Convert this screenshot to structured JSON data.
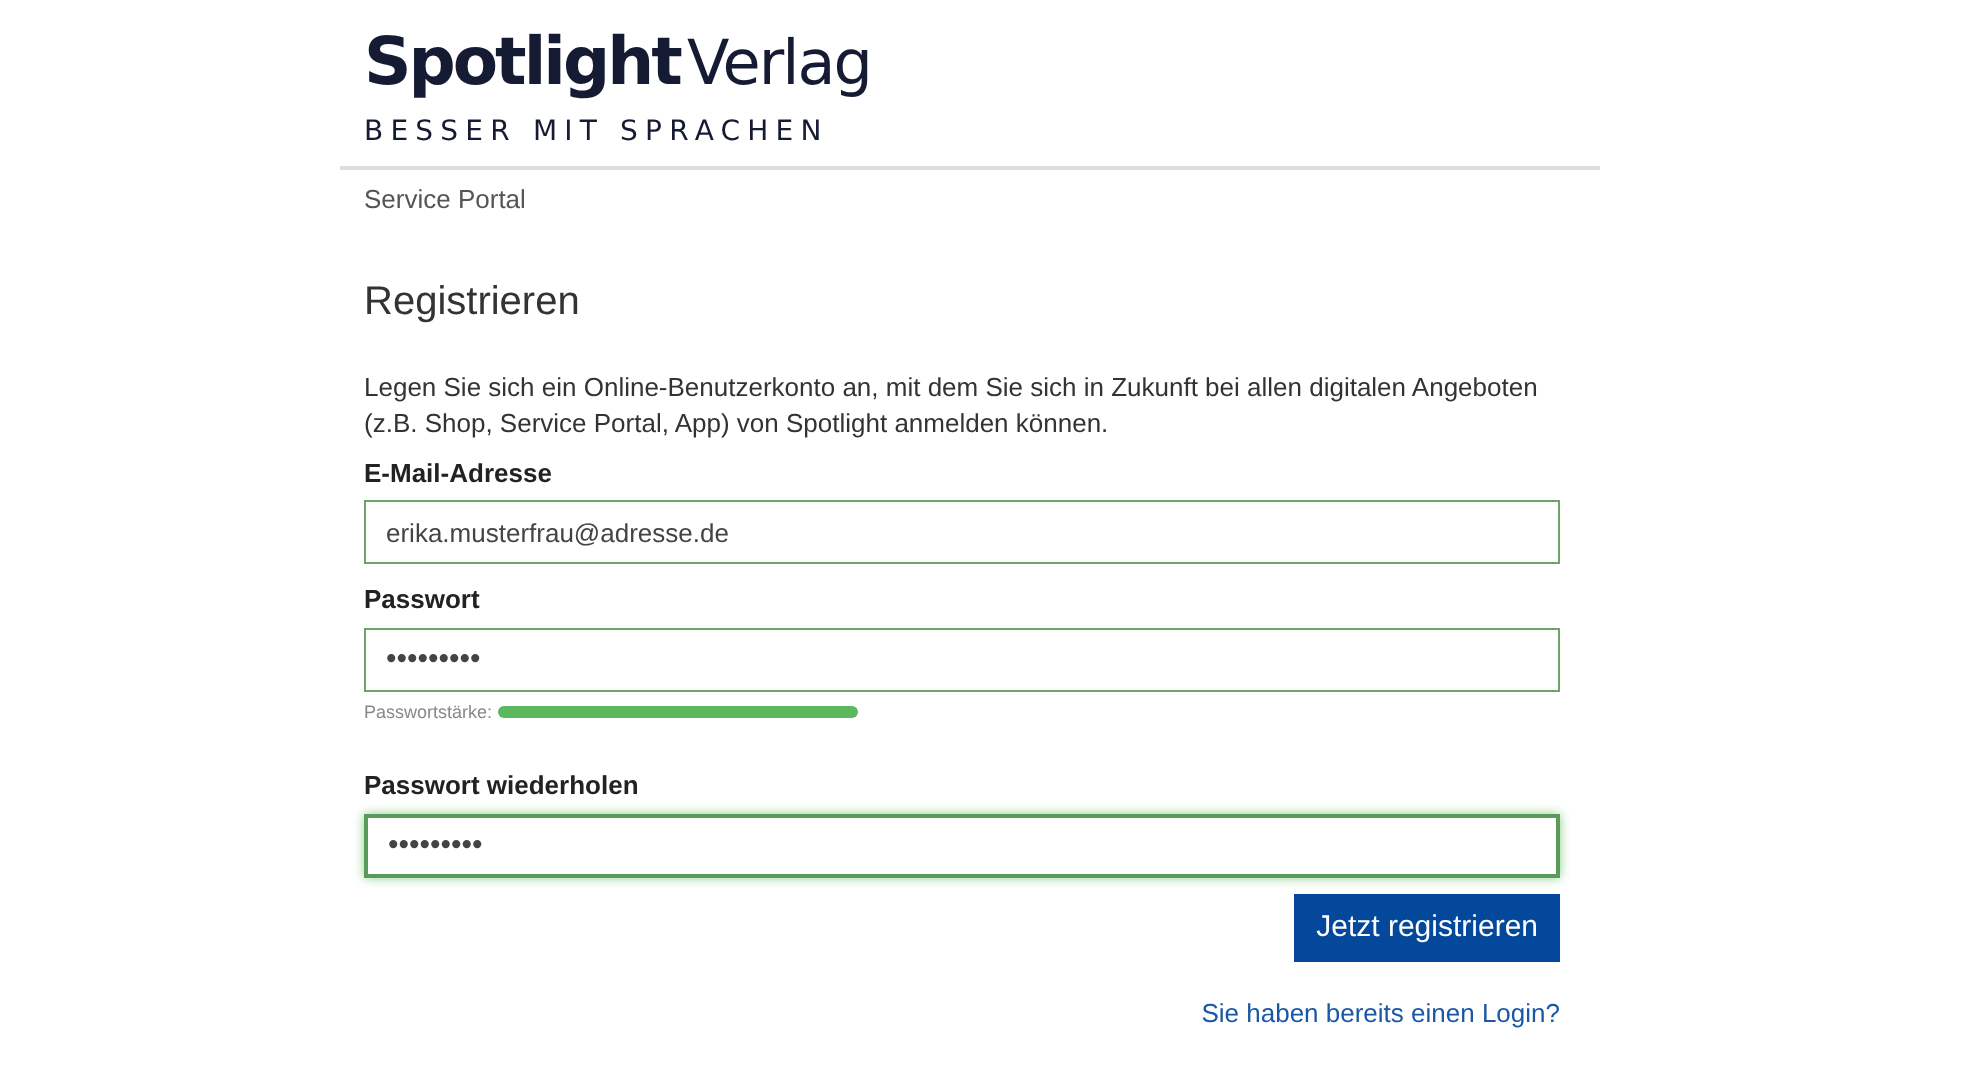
{
  "logo": {
    "brand_bold": "Spotlight",
    "brand_light": "Verlag",
    "tagline": "BESSER MIT SPRACHEN"
  },
  "breadcrumb": "Service Portal",
  "heading": "Registrieren",
  "intro": "Legen Sie sich ein Online-Benutzerkonto an, mit dem Sie sich in Zukunft bei allen digitalen Angeboten (z.B. Shop, Service Portal, App) von Spotlight anmelden können.",
  "fields": [
    {
      "label": "E-Mail-Adresse",
      "value": "erika.musterfrau@adresse.de",
      "focused": false
    },
    {
      "label": "Passwort",
      "value": "•••••••••",
      "focused": false,
      "strength": {
        "label": "Passwortstärke:"
      }
    },
    {
      "label": "Passwort wiederholen",
      "value": "•••••••••",
      "focused": true
    }
  ],
  "submit": "Jetzt registrieren",
  "login_link": "Sie haben bereits einen Login?"
}
